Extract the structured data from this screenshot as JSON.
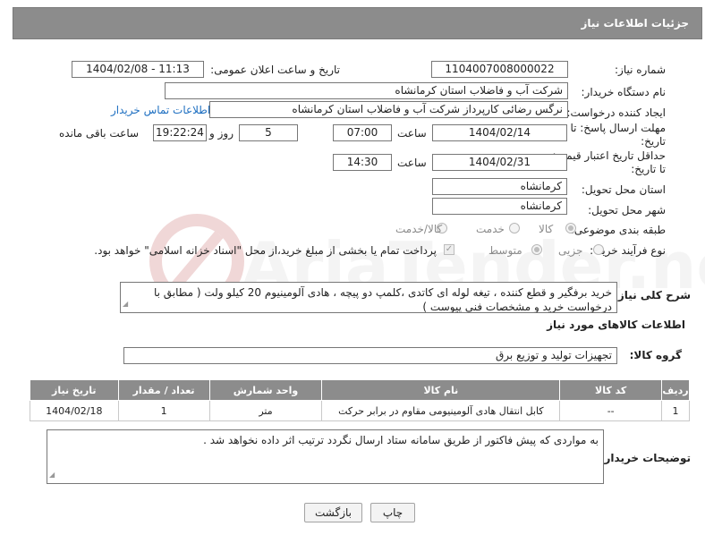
{
  "page_title": "جزئیات اطلاعات نیاز",
  "fields": {
    "need_number_label": "شماره نیاز:",
    "need_number": "1104007008000022",
    "announce_label": "تاریخ و ساعت اعلان عمومی:",
    "announce_value": "1404/02/08 - 11:13",
    "buyer_org_label": "نام دستگاه خریدار:",
    "buyer_org": "شرکت آب و فاضلاب استان کرمانشاه",
    "creator_label": "ایجاد کننده درخواست:",
    "creator": "نرگس رضائی کارپرداز شرکت آب و فاضلاب استان کرمانشاه",
    "contact_link": "اطلاعات تماس خریدار",
    "deadline_label_1": "مهلت ارسال پاسخ: تا",
    "deadline_label_2": "تاریخ:",
    "deadline_date": "1404/02/14",
    "time_label": "ساعت",
    "deadline_time": "07:00",
    "days": "5",
    "days_label": "روز و",
    "remaining": "19:22:24",
    "remaining_label": "ساعت باقی مانده",
    "price_label_1": "حداقل تاریخ اعتبار قیمت:",
    "price_label_2": "تا تاریخ:",
    "price_date": "1404/02/31",
    "price_time": "14:30",
    "province_label": "استان محل تحویل:",
    "province": "کرمانشاه",
    "city_label": "شهر محل تحویل:",
    "city": "کرمانشاه",
    "category_label": "طبقه بندی موضوعی:",
    "category_options": [
      "کالا",
      "خدمت",
      "کالا/خدمت"
    ],
    "process_label": "نوع فرآیند خرید :",
    "process_options": [
      "جزیی",
      "متوسط"
    ],
    "payment_note": "پرداخت تمام یا بخشی از مبلغ خرید،از محل \"اسناد خزانه اسلامی\" خواهد بود.",
    "desc_label": "شرح کلی نیاز:",
    "description": "خرید برفگیر و قطع کننده ، تیغه لوله ای کاتدی ،کلمپ دو پیچه ، هادی آلومینیوم 20 کیلو ولت ( مطابق با درخواست خرید و مشخصات فنی پیوست )",
    "goods_info_label": "اطلاعات کالاهای مورد نیاز",
    "goods_group_label": "گروه کالا:",
    "goods_group": "تجهیزات تولید و توزیع برق",
    "buyer_notes_label": "توضیحات خریدار:",
    "buyer_notes": "به مواردی که پیش فاکتور از طریق سامانه ستاد ارسال نگردد ترتیب اثر داده نخواهد شد ."
  },
  "table": {
    "headers": [
      "ردیف",
      "کد کالا",
      "نام کالا",
      "واحد شمارش",
      "تعداد / مقدار",
      "تاریخ نیاز"
    ],
    "rows": [
      [
        "1",
        "--",
        "کابل انتقال هادی آلومینیومی مقاوم در برابر حرکت",
        "متر",
        "1",
        "1404/02/18"
      ]
    ]
  },
  "buttons": {
    "print": "چاپ",
    "back": "بازگشت"
  },
  "watermark_text": "AriaTender.neT",
  "colors": {
    "header_bg": "#8c8c8c",
    "link": "#1e6fc1",
    "watermark": "#e9c9c9"
  }
}
